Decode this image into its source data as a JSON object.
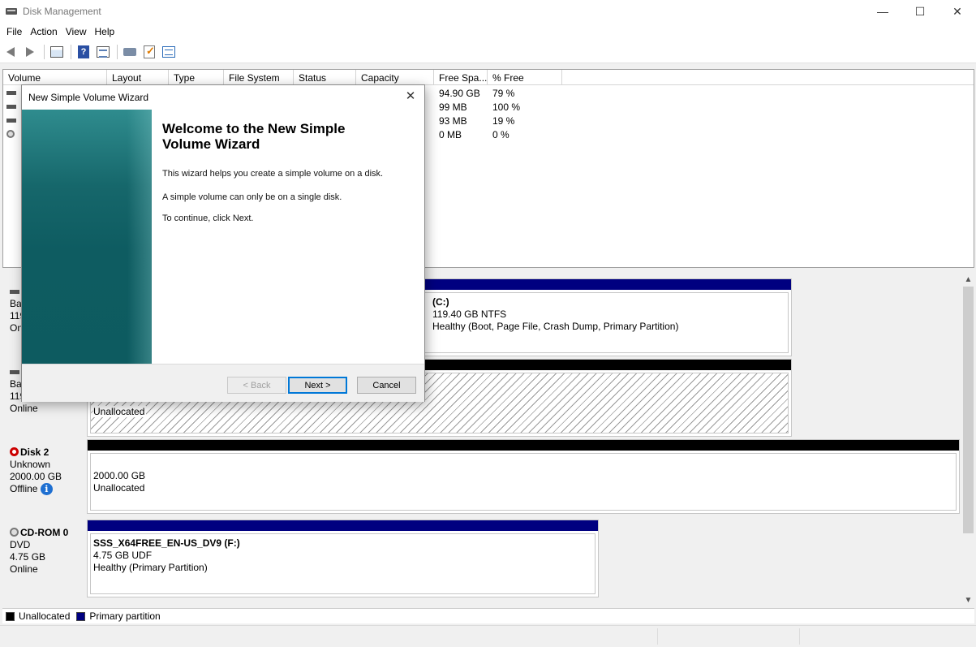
{
  "window": {
    "title": "Disk Management",
    "minimize": "—",
    "maximize": "☐",
    "close": "✕"
  },
  "menu": [
    "File",
    "Action",
    "View",
    "Help"
  ],
  "volume_list": {
    "columns": [
      "Volume",
      "Layout",
      "Type",
      "File System",
      "Status",
      "Capacity",
      "Free Spa...",
      "% Free"
    ],
    "rows": [
      {
        "free": "94.90 GB",
        "pct": "79 %"
      },
      {
        "free": "99 MB",
        "pct": "100 %"
      },
      {
        "free": "93 MB",
        "pct": "19 %"
      },
      {
        "free": "0 MB",
        "pct": "0 %"
      }
    ]
  },
  "disks": {
    "disk0": {
      "label_type": "Ba",
      "label_size": "119",
      "label_status": "On",
      "partition_title": "(C:)",
      "partition_size": "119.40 GB NTFS",
      "partition_status": "Healthy (Boot, Page File, Crash Dump, Primary Partition)"
    },
    "disk1": {
      "label_type": "Ba",
      "label_size": "119",
      "label_status": "Online",
      "partition_status": "Unallocated"
    },
    "disk2": {
      "name": "Disk 2",
      "type": "Unknown",
      "size": "2000.00 GB",
      "status": "Offline",
      "info": "i",
      "partition_size": "2000.00 GB",
      "partition_status": "Unallocated"
    },
    "cdrom0": {
      "name": "CD-ROM 0",
      "type": "DVD",
      "size": "4.75 GB",
      "status": "Online",
      "partition_title": "SSS_X64FREE_EN-US_DV9  (F:)",
      "partition_size": "4.75 GB UDF",
      "partition_status": "Healthy (Primary Partition)"
    }
  },
  "legend": {
    "unallocated": "Unallocated",
    "primary": "Primary partition",
    "unallocated_color": "#000000",
    "primary_color": "#000080"
  },
  "wizard": {
    "title": "New Simple Volume Wizard",
    "heading_line1": "Welcome to the New Simple",
    "heading_line2": "Volume Wizard",
    "text1": "This wizard helps you create a simple volume on a disk.",
    "text2": "A simple volume can only be on a single disk.",
    "text3": "To continue, click Next.",
    "back": "< Back",
    "next": "Next >",
    "cancel": "Cancel",
    "close": "✕"
  }
}
